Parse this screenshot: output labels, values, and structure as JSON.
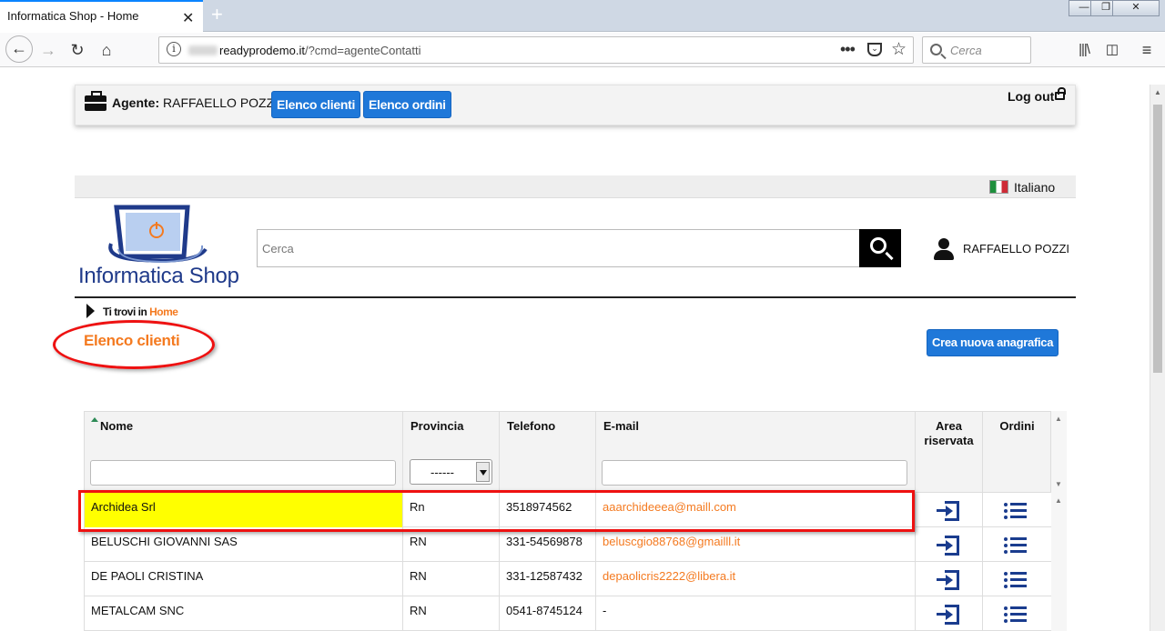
{
  "browser": {
    "tab_title": "Informatica Shop - Home",
    "url_domain": "readyprodemo.it",
    "url_path": "/?cmd=agenteContatti",
    "search_placeholder": "Cerca"
  },
  "agent_bar": {
    "agent_label": "Agente:",
    "agent_name": "RAFFAELLO POZZI",
    "btn_clients": "Elenco clienti",
    "btn_orders": "Elenco ordini",
    "logout": "Log out"
  },
  "language": {
    "label": "Italiano"
  },
  "header": {
    "logo_text": "Informatica Shop",
    "search_placeholder": "Cerca",
    "user_name": "RAFFAELLO POZZI"
  },
  "breadcrumb": {
    "prefix": "Ti trovi in",
    "home": "Home"
  },
  "page": {
    "title": "Elenco clienti",
    "create_button": "Crea nuova anagrafica"
  },
  "table": {
    "columns": {
      "nome": "Nome",
      "provincia": "Provincia",
      "telefono": "Telefono",
      "email": "E-mail",
      "area_line1": "Area",
      "area_line2": "riservata",
      "ordini": "Ordini"
    },
    "province_filter_value": "------",
    "rows": [
      {
        "nome": "Archidea Srl",
        "provincia": "Rn",
        "telefono": "3518974562",
        "email": "aaarchideeea@maill.com"
      },
      {
        "nome": "BELUSCHI GIOVANNI SAS",
        "provincia": "RN",
        "telefono": "331-54569878",
        "email": "beluscgio88768@gmailll.it"
      },
      {
        "nome": "DE PAOLI CRISTINA",
        "provincia": "RN",
        "telefono": "331-12587432",
        "email": "depaolicris2222@libera.it"
      },
      {
        "nome": "METALCAM SNC",
        "provincia": "RN",
        "telefono": "0541-8745124",
        "email": "-"
      }
    ]
  },
  "colors": {
    "accent_orange": "#f47a20",
    "button_blue": "#1f78d9",
    "icon_navy": "#1a3c8e",
    "annotation_red": "#e11111",
    "highlight_yellow": "#ffff00"
  }
}
